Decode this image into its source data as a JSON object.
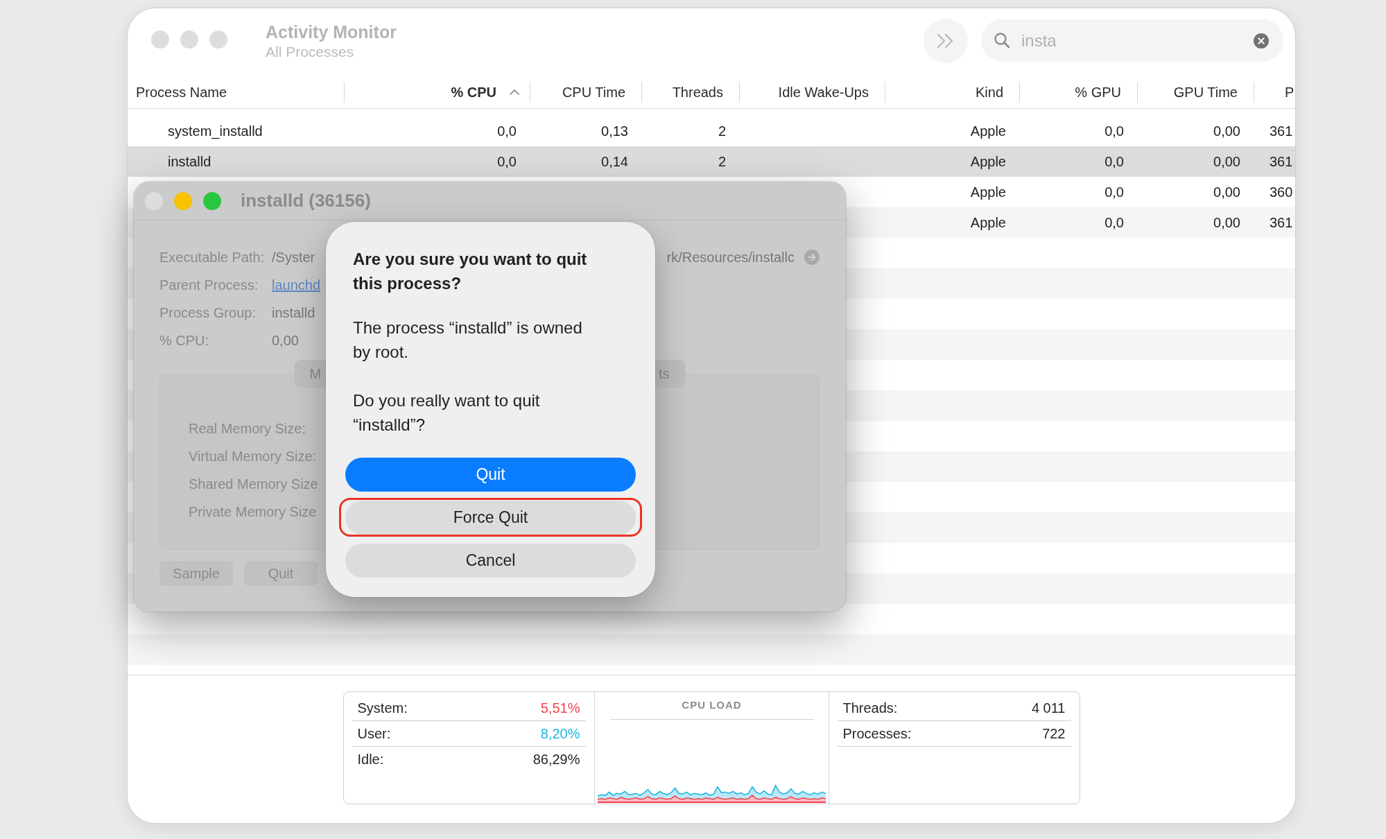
{
  "window": {
    "title": "Activity Monitor",
    "subtitle": "All Processes",
    "window_controls": [
      {
        "disabled": true
      },
      {
        "disabled": true
      },
      {
        "disabled": true
      }
    ]
  },
  "toolbar": {
    "search": {
      "value": "insta"
    }
  },
  "table": {
    "columns": [
      {
        "label": "Process Name",
        "sorted": false
      },
      {
        "label": "% CPU",
        "sorted": true
      },
      {
        "label": "CPU Time",
        "sorted": false
      },
      {
        "label": "Threads",
        "sorted": false
      },
      {
        "label": "Idle Wake-Ups",
        "sorted": false
      },
      {
        "label": "Kind",
        "sorted": false
      },
      {
        "label": "% GPU",
        "sorted": false
      },
      {
        "label": "GPU Time",
        "sorted": false
      },
      {
        "label": "P",
        "sorted": false
      }
    ],
    "rows": [
      {
        "process_name": "system_installd",
        "cpu_percent": "0,0",
        "cpu_time": "0,13",
        "threads": "2",
        "kind": "Apple",
        "gpu_percent": "0,0",
        "gpu_time": "0,00",
        "column_9": "361",
        "selected": false
      },
      {
        "process_name": "installd",
        "cpu_percent": "0,0",
        "cpu_time": "0,14",
        "threads": "2",
        "kind": "Apple",
        "gpu_percent": "0,0",
        "gpu_time": "0,00",
        "column_9": "361",
        "selected": true
      },
      {
        "kind": "Apple",
        "gpu_percent": "0,0",
        "gpu_time": "0,00",
        "column_9": "360",
        "selected": false
      },
      {
        "kind": "Apple",
        "gpu_percent": "0,0",
        "gpu_time": "0,00",
        "column_9": "361",
        "selected": false
      }
    ]
  },
  "process_window": {
    "title": "installd (36156)",
    "window_controls": [
      {
        "disabled": true
      },
      {
        "disabled": false
      },
      {
        "disabled": false
      }
    ],
    "fields": [
      {
        "kind": "path",
        "label": "Executable Path:",
        "value": "/Syster",
        "value_end": "rk/Resources/installc"
      },
      {
        "kind": "link",
        "label": "Parent Process:",
        "value": "launchd"
      },
      {
        "kind": "text",
        "label": "Process Group:",
        "value": "installd"
      },
      {
        "kind": "text",
        "label": "% CPU:",
        "value": "0,00"
      }
    ],
    "tabs": [
      {
        "label": "M"
      },
      {
        "label": "ts"
      }
    ],
    "memory_fields": [
      {
        "label": "Real Memory Size:"
      },
      {
        "label": "Virtual Memory Size:"
      },
      {
        "label": "Shared Memory Size"
      },
      {
        "label": "Private Memory Size"
      }
    ],
    "buttons": [
      {
        "label": "Sample"
      },
      {
        "label": "Quit"
      }
    ]
  },
  "dialog": {
    "title": "Are you sure you want to quit this process?",
    "messages": [
      "The process “installd” is owned by root.",
      "Do you really want to quit “installd”?"
    ],
    "buttons": [
      {
        "label": "Quit",
        "kind": "primary",
        "highlighted": false
      },
      {
        "label": "Force Quit",
        "kind": "default",
        "highlighted": true
      },
      {
        "label": "Cancel",
        "kind": "default",
        "highlighted": false
      }
    ]
  },
  "cpu_summary": {
    "stats": [
      {
        "label": "System:",
        "value": "5,51%",
        "color": "#f3424f"
      },
      {
        "label": "User:",
        "value": "8,20%",
        "color": "#1db4e2"
      },
      {
        "label": "Idle:",
        "value": "86,29%",
        "color": "#262626"
      }
    ],
    "chart_title": "CPU LOAD",
    "counts": [
      {
        "label": "Threads:",
        "value": "4 011"
      },
      {
        "label": "Processes:",
        "value": "722"
      }
    ]
  }
}
